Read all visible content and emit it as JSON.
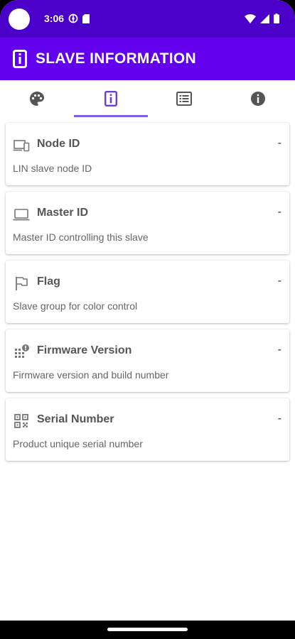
{
  "status_bar": {
    "time": "3:06"
  },
  "app_bar": {
    "title": "SLAVE INFORMATION"
  },
  "tabs": [
    {
      "icon": "palette-icon"
    },
    {
      "icon": "info-box-icon",
      "active": true
    },
    {
      "icon": "list-icon"
    },
    {
      "icon": "info-circle-icon"
    }
  ],
  "cards": [
    {
      "icon": "devices-icon",
      "title": "Node ID",
      "value": "-",
      "description": "LIN slave node ID"
    },
    {
      "icon": "laptop-icon",
      "title": "Master ID",
      "value": "-",
      "description": "Master ID controlling this slave"
    },
    {
      "icon": "flag-icon",
      "title": "Flag",
      "value": "-",
      "description": "Slave group for color control"
    },
    {
      "icon": "firmware-icon",
      "title": "Firmware Version",
      "value": "-",
      "description": "Firmware version and build number"
    },
    {
      "icon": "qr-code-icon",
      "title": "Serial Number",
      "value": "-",
      "description": "Product unique serial number"
    }
  ],
  "colors": {
    "status_bar": "#4a00c8",
    "app_bar": "#6200ee",
    "tab_indicator": "#7b5fe0"
  }
}
